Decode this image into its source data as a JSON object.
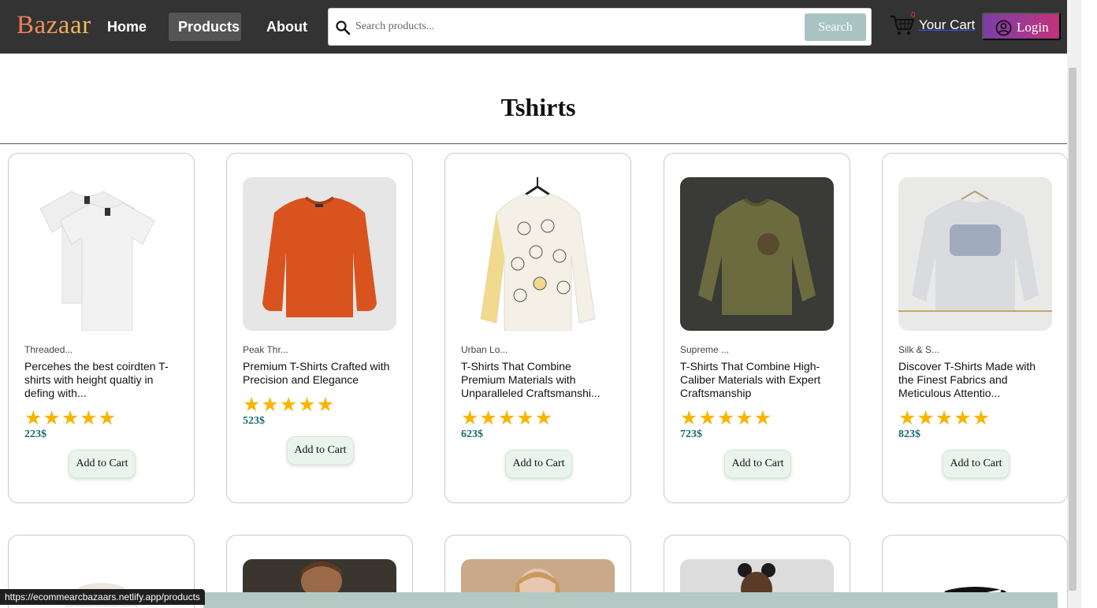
{
  "nav": {
    "logo": "Bazaar",
    "links": [
      "Home",
      "Products",
      "About"
    ],
    "active_link": "Products",
    "search": {
      "placeholder": "Search products...",
      "value": "",
      "button_label": "Search"
    },
    "cart": {
      "label": "Your Cart",
      "count": "0",
      "icon": "cart-icon"
    },
    "login": {
      "label": "Login",
      "icon": "user-circle-icon"
    }
  },
  "colors": {
    "navbar": "#333333",
    "active_nav": "#555555",
    "search_button": "#a8c3c1",
    "login_gradient_start": "#7a3fa8",
    "login_gradient_end": "#c2337a",
    "star": "#f7b500",
    "price": "#1a6a70",
    "add_button": "#e9f5ec"
  },
  "page": {
    "title": "Tshirts"
  },
  "products": [
    {
      "brand": "Threaded...",
      "title": "Percehes the best coirdten T-shirts with height qualtiy in defing with...",
      "rating": 5,
      "stars": "★★★★★",
      "price": "223$",
      "button": "Add to Cart",
      "image": "two white t-shirts"
    },
    {
      "brand": "Peak Thr...",
      "title": "Premium T-Shirts Crafted with Precision and Elegance",
      "rating": 5,
      "stars": "★★★★★",
      "price": "523$",
      "button": "Add to Cart",
      "image": "orange knit sweater"
    },
    {
      "brand": "Urban Lo...",
      "title": "T-Shirts That Combine Premium Materials with Unparalleled Craftsmanshi...",
      "rating": 5,
      "stars": "★★★★★",
      "price": "623$",
      "button": "Add to Cart",
      "image": "white cat-print sweatshirt on hanger"
    },
    {
      "brand": "Supreme ...",
      "title": "T-Shirts That Combine High-Caliber Materials with Expert Craftsmanship",
      "rating": 5,
      "stars": "★★★★★",
      "price": "723$",
      "button": "Add to Cart",
      "image": "olive green sweatshirt"
    },
    {
      "brand": "Silk & S...",
      "title": "Discover T-Shirts Made with the Finest Fabrics and Meticulous Attentio...",
      "rating": 5,
      "stars": "★★★★★",
      "price": "823$",
      "button": "Add to Cart",
      "image": "light grey printed sweatshirt on hanger"
    }
  ],
  "status_bar": {
    "url": "https://ecommearcbazaars.netlify.app/products"
  }
}
